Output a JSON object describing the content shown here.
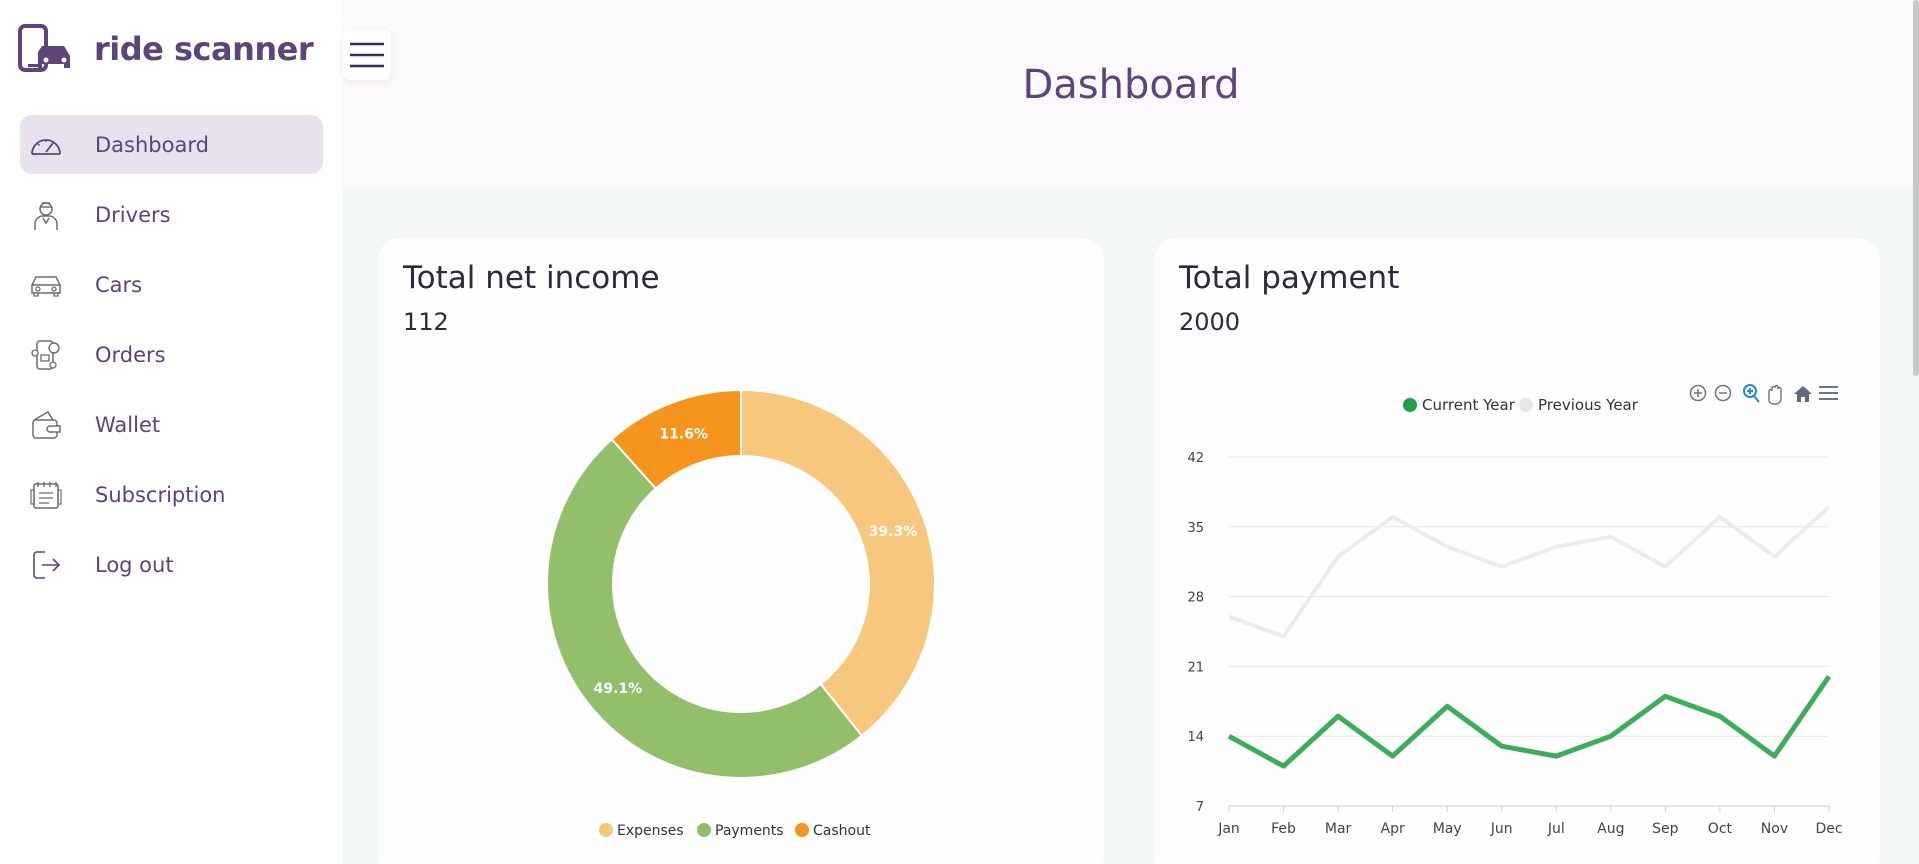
{
  "app": {
    "name": "ride scanner"
  },
  "sidebar": {
    "items": [
      {
        "label": "Dashboard",
        "icon": "speedometer-icon",
        "active": true
      },
      {
        "label": "Drivers",
        "icon": "driver-icon",
        "active": false
      },
      {
        "label": "Cars",
        "icon": "car-icon",
        "active": false
      },
      {
        "label": "Orders",
        "icon": "orders-icon",
        "active": false
      },
      {
        "label": "Wallet",
        "icon": "wallet-icon",
        "active": false
      },
      {
        "label": "Subscription",
        "icon": "subscription-icon",
        "active": false
      },
      {
        "label": "Log out",
        "icon": "logout-icon",
        "active": false
      }
    ]
  },
  "header": {
    "title": "Dashboard"
  },
  "colors": {
    "brand": "#5d4479",
    "active_bg": "#e8e1ee",
    "expenses": "#f6c77c",
    "payments": "#93bf6b",
    "cashout": "#f7941e",
    "current_year": "#3cad5a",
    "previous_year": "#ececec"
  },
  "income_card": {
    "title": "Total net income",
    "value": "112"
  },
  "payment_card": {
    "title": "Total payment",
    "value": "2000"
  },
  "chart_data": [
    {
      "type": "pie",
      "variant": "donut",
      "labels": [
        "Expenses",
        "Payments",
        "Cashout"
      ],
      "values": [
        39.3,
        49.1,
        11.6
      ],
      "data_labels": [
        "39.3%",
        "49.1%",
        "11.6%"
      ],
      "legend": "bottom"
    },
    {
      "type": "line",
      "categories": [
        "Jan",
        "Feb",
        "Mar",
        "Apr",
        "May",
        "Jun",
        "Jul",
        "Aug",
        "Sep",
        "Oct",
        "Nov",
        "Dec"
      ],
      "series": [
        {
          "name": "Current Year",
          "values": [
            14,
            11,
            16,
            12,
            17,
            13,
            12,
            14,
            18,
            16,
            12,
            20
          ]
        },
        {
          "name": "Previous Year",
          "values": [
            26,
            24,
            32,
            36,
            33,
            31,
            33,
            34,
            31,
            36,
            32,
            37
          ]
        }
      ],
      "yticks": [
        7,
        14,
        21,
        28,
        35,
        42
      ],
      "ylim": [
        7,
        42
      ],
      "grid": true,
      "legend": "top",
      "toolbar": [
        "zoom-in-icon",
        "zoom-out-icon",
        "zoom-select-icon",
        "pan-hand-icon",
        "home-icon",
        "menu-icon"
      ]
    }
  ]
}
